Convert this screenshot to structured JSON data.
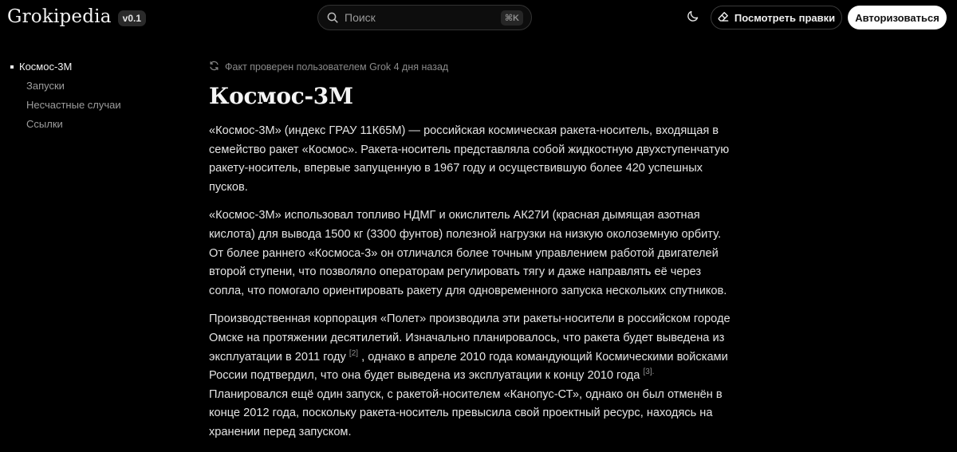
{
  "header": {
    "logo": "Grokipedia",
    "version": "v0.1",
    "search_placeholder": "Поиск",
    "search_shortcut": "⌘K",
    "edits_button": "Посмотреть правки",
    "login_button": "Авторизоваться"
  },
  "toc": {
    "items": [
      {
        "label": "Космос-3М",
        "active": true
      },
      {
        "label": "Запуски"
      },
      {
        "label": "Несчастные случаи"
      },
      {
        "label": "Ссылки"
      }
    ]
  },
  "article": {
    "fact_check": "Факт проверен пользователем Grok 4 дня назад",
    "title": "Космос-3М",
    "p1": "«Космос-3М» (индекс ГРАУ 11К65М) — российская космическая ракета-носитель, входящая в семейство ракет «Космос». Ракета-носитель представляла собой жидкостную двухступенчатую ракету-носитель, впервые запущенную в 1967 году и осуществившую более 420 успешных пусков.",
    "p2": "«Космос-3М» использовал топливо НДМГ и окислитель АК27И (красная дымящая азотная кислота) для вывода 1500 кг (3300 фунтов) полезной нагрузки на низкую околоземную орбиту. От более раннего «Космоса-3» он отличался более точным управлением работой двигателей второй ступени, что позволяло операторам регулировать тягу и даже направлять её через сопла, что помогало ориентировать ракету для одновременного запуска нескольких спутников.",
    "p3_a": "Производственная корпорация «Полет» производила эти ракеты-носители в российском городе Омске на протяжении десятилетий. Изначально планировалось, что ракета будет выведена из эксплуатации в 2011 году",
    "ref2": "[2]",
    "p3_b": ", однако в апреле 2010 года командующий Космическими войсками России подтвердил, что она будет выведена из эксплуатации к концу 2010 года",
    "ref3": "[3].",
    "p3_c": "Планировался ещё один запуск, с ракетой-носителем «Канопус-СТ», однако он был отменён в конце 2012 года, поскольку ракета-носитель превысила свой проектный ресурс, находясь на хранении перед запуском."
  }
}
